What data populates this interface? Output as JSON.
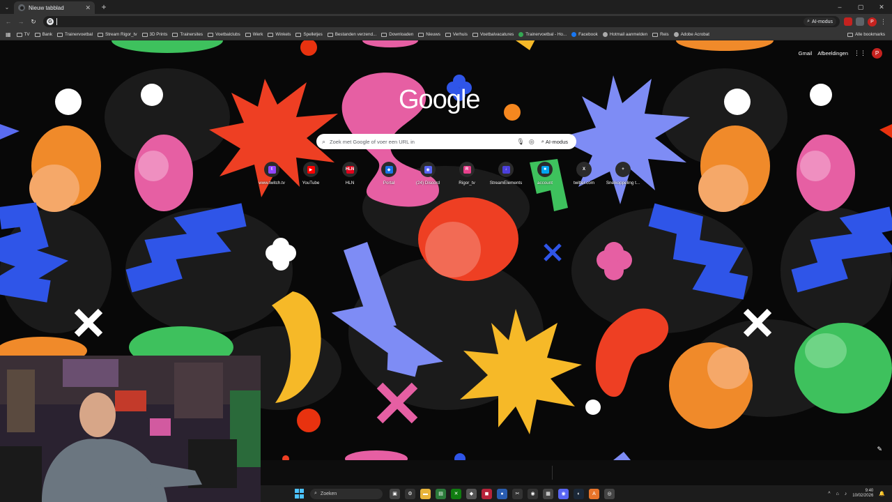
{
  "browser": {
    "tab_title": "Nieuw tabblad",
    "new_tab": "+",
    "window_controls": [
      "–",
      "▢",
      "✕"
    ]
  },
  "toolbar": {
    "omnibox_value": "",
    "ai_chip": "AI-modus",
    "profile_initial": "P"
  },
  "bookmarks": [
    {
      "label": "TV",
      "type": "folder"
    },
    {
      "label": "Bank",
      "type": "folder"
    },
    {
      "label": "Trainervoetbal",
      "type": "folder"
    },
    {
      "label": "Stream Rigor_tv",
      "type": "folder"
    },
    {
      "label": "3D Prints",
      "type": "folder"
    },
    {
      "label": "Trainersites",
      "type": "folder"
    },
    {
      "label": "Voetbalclubs",
      "type": "folder"
    },
    {
      "label": "Werk",
      "type": "folder"
    },
    {
      "label": "Winkels",
      "type": "folder"
    },
    {
      "label": "Spelletjes",
      "type": "folder"
    },
    {
      "label": "Bestanden verzend...",
      "type": "folder"
    },
    {
      "label": "Downloaden",
      "type": "folder"
    },
    {
      "label": "Nieuws",
      "type": "folder"
    },
    {
      "label": "Verhuis",
      "type": "folder"
    },
    {
      "label": "Voetbalvacatures",
      "type": "folder"
    },
    {
      "label": "Trainervoetbal - Ho...",
      "type": "site",
      "color": "#34a853"
    },
    {
      "label": "Facebook",
      "type": "site",
      "color": "#1877f2"
    },
    {
      "label": "Hotmail aanmelden",
      "type": "site",
      "color": "#aaaaaa"
    },
    {
      "label": "Reis",
      "type": "folder"
    },
    {
      "label": "Adobe Acrobat",
      "type": "site",
      "color": "#aaaaaa"
    }
  ],
  "all_bookmarks": "Alle bookmarks",
  "google": {
    "gmail": "Gmail",
    "images": "Afbeeldingen",
    "avatar": "P",
    "logo": "Google",
    "search_placeholder": "Zoek met Google of voer een URL in",
    "ai_mode": "AI-modus"
  },
  "shortcuts": [
    {
      "label": "www.twitch.tv",
      "color": "#9146ff",
      "glyph": "t"
    },
    {
      "label": "YouTube",
      "color": "#ff0000",
      "glyph": "▶"
    },
    {
      "label": "HLN",
      "color": "#e3001b",
      "glyph": "HLN"
    },
    {
      "label": "Portal",
      "color": "#1a73e8",
      "glyph": "◆"
    },
    {
      "label": "(24) Discord",
      "color": "#5865f2",
      "glyph": "◉"
    },
    {
      "label": "Rigor_tv",
      "color": "#e8408c",
      "glyph": "R"
    },
    {
      "label": "StreamElements",
      "color": "#4b3fdb",
      "glyph": "↓"
    },
    {
      "label": "account",
      "color": "#00a4ef",
      "glyph": "■"
    },
    {
      "label": "twitter.com",
      "color": "#2b2b2b",
      "glyph": "X"
    },
    {
      "label": "Snelkoppeling t...",
      "color": "#2b2b2b",
      "glyph": "+"
    }
  ],
  "taskbar": {
    "search": "Zoeken",
    "time": "9:40",
    "date": "10/02/2026"
  }
}
